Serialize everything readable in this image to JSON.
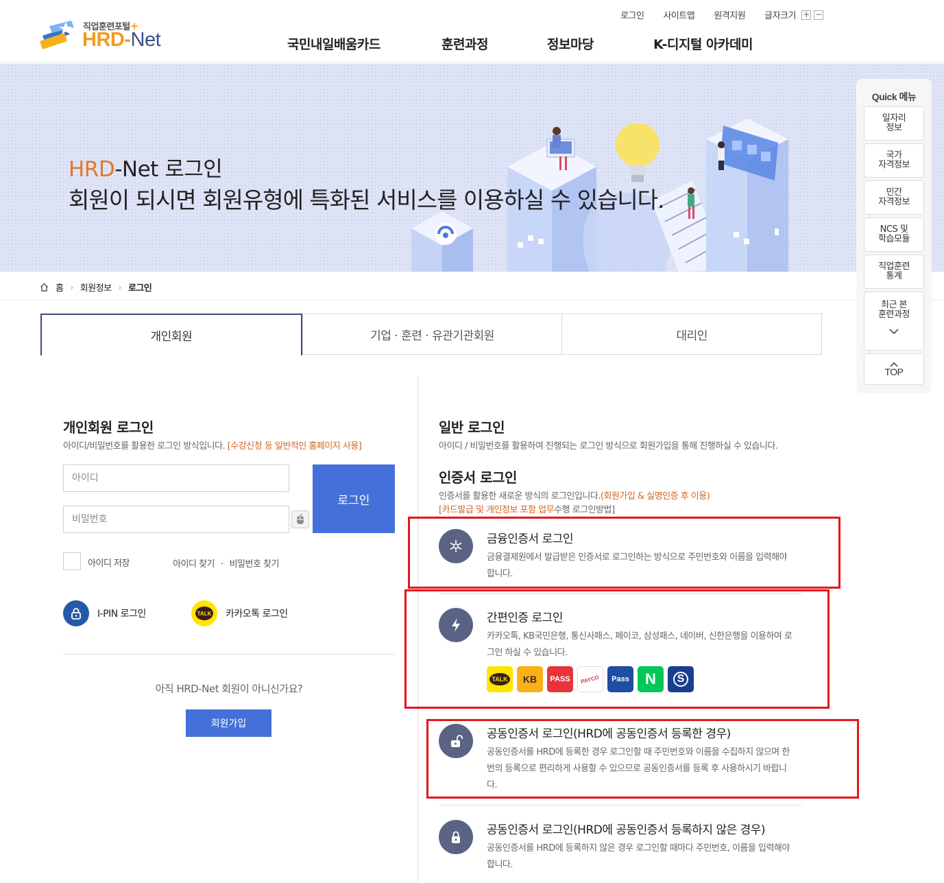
{
  "header": {
    "logo_sub": "직업훈련포털",
    "logo_plus": "+",
    "logo_hrd": "HRD",
    "logo_dash": "-",
    "logo_net": "Net",
    "util": {
      "login": "로그인",
      "sitemap": "사이트맵",
      "remote": "원격지원",
      "font_size": "글자크기",
      "plus": "+",
      "minus": "−"
    },
    "gnb": [
      "국민내일배움카드",
      "훈련과정",
      "정보마당",
      "K-디지털 아카데미"
    ]
  },
  "banner": {
    "title_hrd": "HRD",
    "title_rest": "-Net 로그인",
    "subtitle": "회원이 되시면 회원유형에 특화된 서비스를 이용하실 수 있습니다."
  },
  "breadcrumb": [
    "홈",
    "회원정보",
    "로그인"
  ],
  "tabs": [
    "개인회원",
    "기업 · 훈련 · 유관기관회원",
    "대리인"
  ],
  "personal": {
    "title": "개인회원 로그인",
    "desc": "아이디/비밀번호를 활용한 로그인 방식입니다.",
    "desc_hl": "[수강신청 등 일반적인 홈페이지 사용]",
    "id_placeholder": "아이디",
    "pw_placeholder": "비밀번호",
    "login_button": "로그인",
    "save_id": "아이디 저장",
    "find_id": "아이디 찾기",
    "find_sep": "·",
    "find_pw": "비밀번호 찾기",
    "ipin": "I-PIN 로그인",
    "kakao": "카카오톡 로그인",
    "kakao_badge": "TALK",
    "not_member": "아직 HRD-Net 회원이 아니신가요?",
    "join_button": "회원가입"
  },
  "general": {
    "title": "일반 로그인",
    "desc": "아이디 / 비밀번호를 활용하여 진행되는 로그인 방식으로 회원가입을 통해 진행하실 수 있습니다."
  },
  "cert": {
    "title": "인증서 로그인",
    "desc": "인증서를 활용한 새로운 방식의 로그인입니다.",
    "desc_hl": "(회원가입 & 실명인증 후 이용)",
    "desc2_hl": "[카드발급 및 개인정보 포함 업무",
    "desc2": "수행 로그인방법]"
  },
  "options": [
    {
      "title": "금융인증서 로그인",
      "desc": "금융결제원에서 발급받은 인증서로 로그인하는 방식으로 주민번호와 이름을 입력해야 합니다."
    },
    {
      "title": "간편인증 로그인",
      "desc": "카카오톡, KB국민은행, 통신사패스, 페이코, 삼성패스, 네이버, 신한은행을 이용하여 로그인 하실 수 있습니다."
    },
    {
      "title": "공동인증서 로그인(HRD에 공동인증서 등록한 경우)",
      "desc": "공동인증서를 HRD에 등록한 경우 로그인할 때 주민번호와 이름을 수집하지 않으며 한번의 등록으로 편리하게 사용할 수 있으므로 공동인증서를 등록 후 사용하시기 바랍니다."
    },
    {
      "title": "공동인증서 로그인(HRD에 공동인증서 등록하지 않은 경우)",
      "desc": "공동인증서를 HRD에 등록하지 않은 경우 로그인할 때마다 주민번호, 이름을 입력해야 합니다."
    }
  ],
  "providers": [
    {
      "label": "TALK",
      "bg": "#fee500",
      "fg": "#3a1d1d"
    },
    {
      "label": "KB",
      "bg": "#fcaf17",
      "fg": "#3b3b3b"
    },
    {
      "label": "PASS",
      "bg": "#e8333b",
      "fg": "#ffffff"
    },
    {
      "label": "PAYCO",
      "bg": "#ffffff",
      "fg": "#e8333b"
    },
    {
      "label": "Pass",
      "bg": "#1e4da1",
      "fg": "#ffffff"
    },
    {
      "label": "N",
      "bg": "#03c75a",
      "fg": "#ffffff"
    },
    {
      "label": "S",
      "bg": "#1a3d8f",
      "fg": "#ffffff"
    }
  ],
  "quick": {
    "title": "Quick 메뉴",
    "items": [
      "일자리\n정보",
      "국가\n자격정보",
      "민간\n자격정보",
      "NCS 및\n학습모듈",
      "직업훈련\n통계",
      "최근 본\n훈련과정"
    ],
    "top": "TOP"
  },
  "colors": {
    "accent": "#4670d9",
    "orange": "#e0782a",
    "highlight_box": "#e5141d",
    "icon_circle": "#5a6384"
  }
}
